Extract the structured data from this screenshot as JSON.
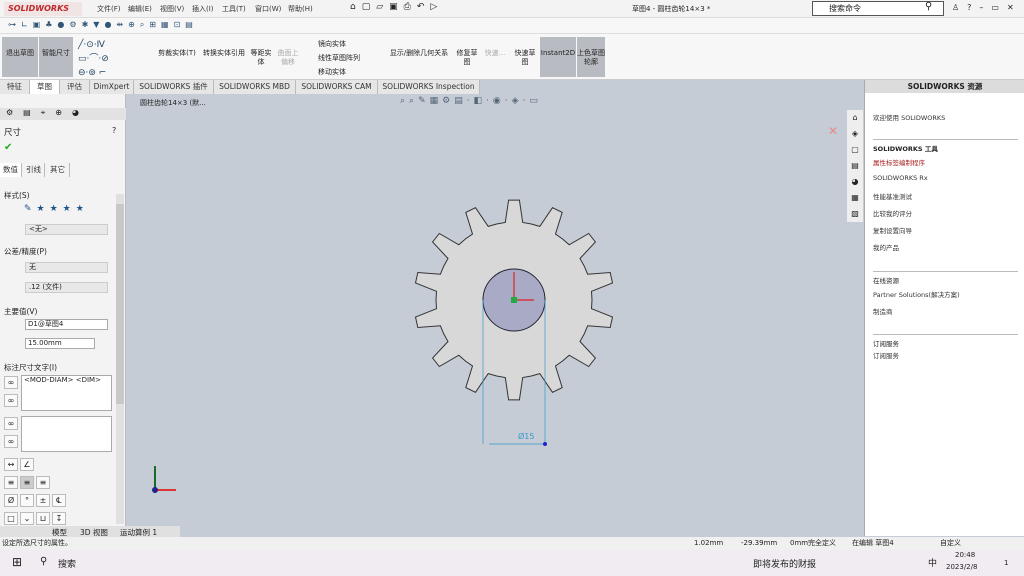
{
  "app": {
    "logo": "SOLIDWORKS",
    "title": "草图4 - 圆柱齿轮14×3 *",
    "menu": [
      "文件(F)",
      "编辑(E)",
      "视图(V)",
      "插入(I)",
      "工具(T)",
      "窗口(W)",
      "帮助(H)"
    ],
    "search_placeholder": "搜索命令"
  },
  "ribbon": {
    "exit_sketch": "退出草图",
    "smart_dim": "智能尺寸",
    "trim": "剪裁实体(T)",
    "convert": "转换实体引用",
    "offset": "等距实体",
    "surface_offset": "曲面上偏移",
    "mirror": "镜向实体",
    "linear_pattern": "线性草图阵列",
    "move": "移动实体",
    "show_relations": "显示/删除几何关系",
    "repair": "修复草图",
    "quick_snap": "快速...",
    "rapid_sketch": "快速草图",
    "instant2d": "Instant2D",
    "shaded": "上色草图轮廓"
  },
  "tabs": [
    "特征",
    "草图",
    "评估",
    "DimXpert",
    "SOLIDWORKS 插件",
    "SOLIDWORKS MBD",
    "SOLIDWORKS CAM",
    "SOLIDWORKS Inspection"
  ],
  "tree": {
    "item": "圆柱齿轮14×3 (默..."
  },
  "pm": {
    "title": "尺寸",
    "subtabs": [
      "数值",
      "引线",
      "其它"
    ],
    "style_label": "样式(S)",
    "style_value": "<无>",
    "tol_label": "公差/精度(P)",
    "tol_value": "无",
    "precision_value": ".12 (文件)",
    "primary_label": "主要值(V)",
    "name_value": "D1@草图4",
    "dim_value": "15.00mm",
    "text_label": "标注尺寸文字(I)",
    "text_value": "<MOD-DIAM> <DIM>"
  },
  "viewport": {
    "dim_label": "Ø15"
  },
  "resources": {
    "title": "SOLIDWORKS 资源",
    "welcome": "欢迎使用 SOLIDWORKS",
    "tools_header": "SOLIDWORKS 工具",
    "tools": [
      "属性标签编制程序",
      "SOLIDWORKS Rx",
      "性能基准测试",
      "比较我的评分",
      "复制设置向导",
      "我的产品"
    ],
    "online_header": "在线资源",
    "online": [
      "Partner Solutions(解决方案)",
      "制造商"
    ],
    "sub_header": "订阅服务",
    "sub": [
      "订阅服务"
    ]
  },
  "bottom_tabs": [
    "模型",
    "3D 视图",
    "运动算例 1"
  ],
  "status": {
    "hint": "设定所选尺寸的属性。",
    "x": "1.02mm",
    "y": "-29.39mm",
    "z": "0mm",
    "state": "完全定义",
    "editing": "在编辑 草图4",
    "units": "自定义"
  },
  "taskbar": {
    "search": "搜索",
    "news": "即将发布的财报",
    "ime": "中",
    "time": "20:48",
    "date": "2023/2/8",
    "notif": "1"
  },
  "colors": {
    "accent": "#c0282a",
    "gear_fill": "#d8d8d8",
    "hole_fill": "#a9aac6"
  }
}
